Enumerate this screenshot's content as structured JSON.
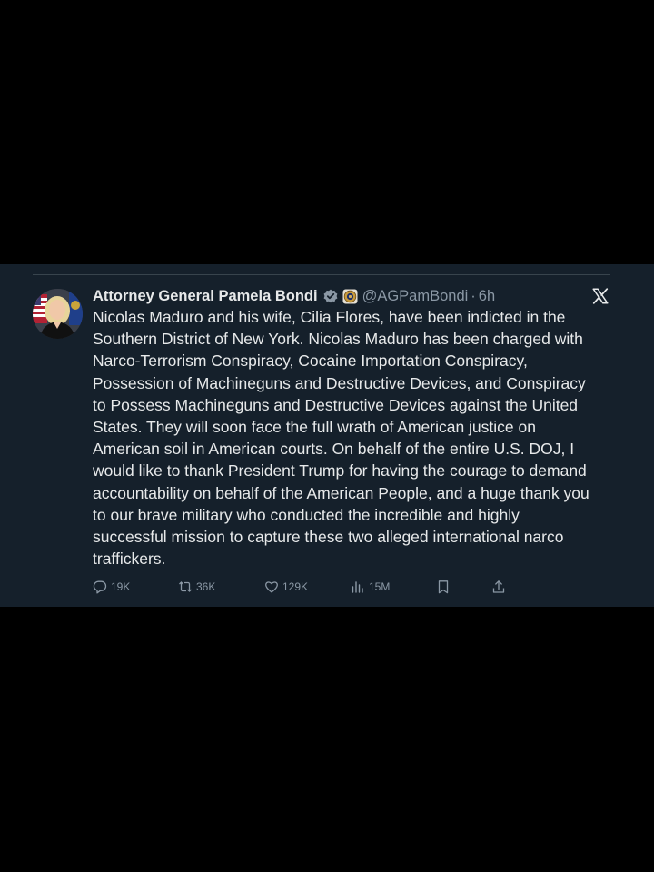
{
  "tweet": {
    "author": {
      "display_name": "Attorney General Pamela Bondi",
      "handle": "@AGPamBondi",
      "separator": "·",
      "time": "6h",
      "verified_color": "#8b98a5"
    },
    "body_lines": [
      "Nicolas Maduro and his wife, Cilia Flores, have been indicted in the",
      "Southern District of New York.  Nicolas Maduro has been charged with",
      "Narco-Terrorism Conspiracy, Cocaine Importation Conspiracy,",
      "Possession of Machineguns and Destructive Devices, and Conspiracy",
      "to Possess Machineguns and Destructive Devices against the United",
      "States.  They will soon face the full wrath of American justice on",
      "American soil in American courts. On behalf of the entire U.S. DOJ, I",
      "would like to thank President Trump for having the courage to demand",
      "accountability on behalf of the American People, and a huge thank you",
      "to our brave military who conducted the incredible and highly",
      "successful mission to capture these two alleged international narco",
      "traffickers."
    ],
    "actions": {
      "replies": "19K",
      "reposts": "36K",
      "likes": "129K",
      "views": "15M"
    }
  },
  "icons": {
    "verified": "verified-badge-icon",
    "affiliate": "doj-seal-icon",
    "brand": "x-logo-icon",
    "reply": "reply-icon",
    "repost": "repost-icon",
    "like": "heart-icon",
    "views": "views-icon",
    "bookmark": "bookmark-icon",
    "share": "share-icon"
  },
  "colors": {
    "background": "#15202b",
    "text": "#e7e9ea",
    "secondary": "#8b98a5"
  }
}
